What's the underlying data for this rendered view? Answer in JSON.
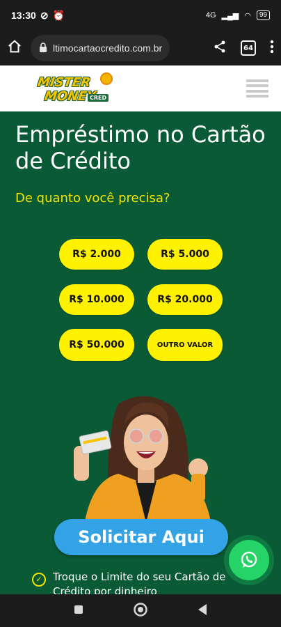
{
  "status_bar": {
    "time": "13:30",
    "network": "4G",
    "battery": "99"
  },
  "browser": {
    "url": "ltimocartaocredito.com.br",
    "tab_count": "64"
  },
  "logo": {
    "line1": "MISTER",
    "line2": "MONEY",
    "tag": "CRED"
  },
  "hero": {
    "title": "Empréstimo no Cartão de Crédito",
    "subtitle": "De quanto você precisa?"
  },
  "amounts": [
    {
      "label": "R$ 2.000"
    },
    {
      "label": "R$ 5.000"
    },
    {
      "label": "R$ 10.000"
    },
    {
      "label": "R$ 20.000"
    },
    {
      "label": "R$ 50.000"
    },
    {
      "label": "OUTRO VALOR"
    }
  ],
  "cta": {
    "label": "Solicitar Aqui"
  },
  "benefits": [
    {
      "text": "Troque o Limite do seu Cartão de Crédito por dinheiro"
    }
  ],
  "colors": {
    "brand_green": "#0a5a35",
    "button_yellow": "#fff200",
    "cta_blue": "#33a3e6",
    "whatsapp": "#25d366"
  }
}
